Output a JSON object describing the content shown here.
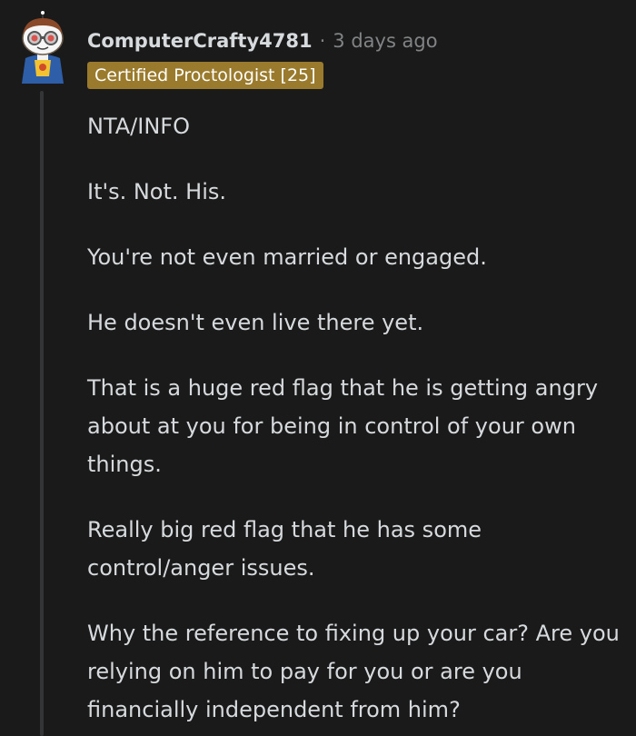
{
  "comment": {
    "username": "ComputerCrafty4781",
    "separator": "·",
    "timestamp": "3 days ago",
    "flair": "Certified Proctologist [25]",
    "flair_color": "#9a7a2c",
    "avatar_icon": "snoo-avatar-icon",
    "paragraphs": [
      "NTA/INFO",
      "It's. Not. His.",
      "You're not even married or engaged.",
      "He doesn't even live there yet.",
      "That is a huge red flag that he is getting angry about at you for being in control of your own things.",
      "Really big red flag that he has some control/anger issues.",
      "Why the reference to fixing up your car? Are you relying on him to pay for you or are you financially independent from him?"
    ]
  }
}
